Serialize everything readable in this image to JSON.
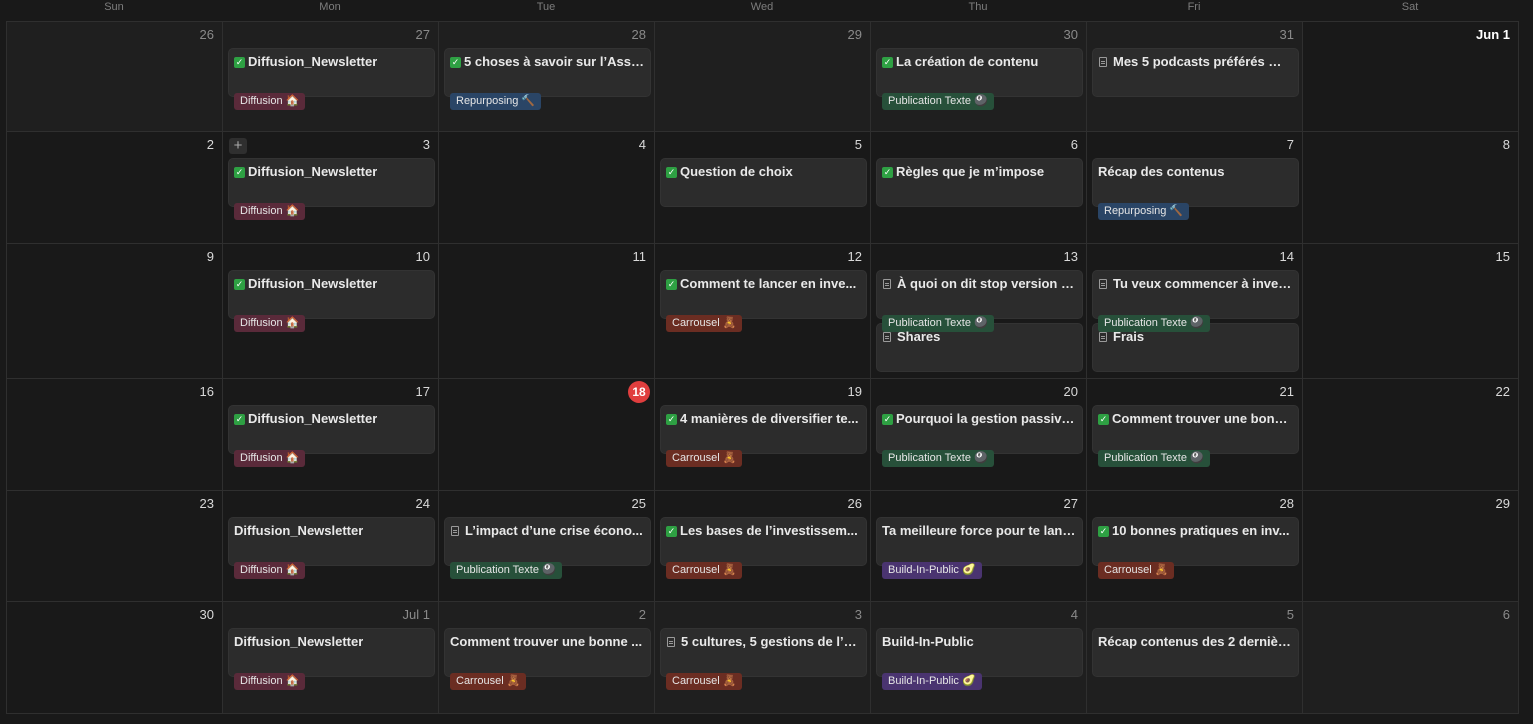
{
  "weekdays": [
    "Sun",
    "Mon",
    "Tue",
    "Wed",
    "Thu",
    "Fri",
    "Sat"
  ],
  "today_label": "18",
  "tag_colors": {
    "Diffusion": "#5a2a3a",
    "Repurposing": "#2a4566",
    "Publication Texte": "#27503a",
    "Carrousel": "#6b2d22",
    "Build-In-Public": "#4a3470"
  },
  "tags": {
    "Diffusion": "Diffusion 🏠",
    "Repurposing": "Repurposing 🔨",
    "Publication Texte": "Publication Texte 🎱",
    "Carrousel": "Carrousel 🧸",
    "Build-In-Public": "Build-In-Public 🥑"
  },
  "weeks": [
    {
      "days": [
        {
          "label": "26",
          "muted": true,
          "events": []
        },
        {
          "label": "27",
          "muted": true,
          "events": [
            {
              "title": "Diffusion_Newsletter",
              "icon": "check",
              "tag": "Diffusion"
            }
          ]
        },
        {
          "label": "28",
          "muted": true,
          "events": [
            {
              "title": "5 choses à savoir sur l’Assu...",
              "icon": "check",
              "tag": "Repurposing"
            }
          ]
        },
        {
          "label": "29",
          "muted": true,
          "events": []
        },
        {
          "label": "30",
          "muted": true,
          "events": [
            {
              "title": "La création de contenu",
              "icon": "check",
              "tag": "Publication Texte"
            }
          ]
        },
        {
          "label": "31",
          "muted": true,
          "events": [
            {
              "title": "Mes 5 podcasts préférés ⤵ ...",
              "icon": "doc",
              "tag": null
            }
          ]
        },
        {
          "label": "Jun 1",
          "muted": false,
          "month_start": true,
          "events": []
        }
      ]
    },
    {
      "add_button": true,
      "days": [
        {
          "label": "2",
          "events": []
        },
        {
          "label": "3",
          "events": [
            {
              "title": "Diffusion_Newsletter",
              "icon": "check",
              "tag": "Diffusion"
            }
          ]
        },
        {
          "label": "4",
          "events": []
        },
        {
          "label": "5",
          "events": [
            {
              "title": "Question de choix",
              "icon": "check",
              "tag": null
            }
          ]
        },
        {
          "label": "6",
          "events": [
            {
              "title": "Règles que je m’impose",
              "icon": "check",
              "tag": null
            }
          ]
        },
        {
          "label": "7",
          "events": [
            {
              "title": "Récap des contenus",
              "icon": null,
              "tag": "Repurposing"
            }
          ]
        },
        {
          "label": "8",
          "events": []
        }
      ]
    },
    {
      "days": [
        {
          "label": "9",
          "events": []
        },
        {
          "label": "10",
          "events": [
            {
              "title": "Diffusion_Newsletter",
              "icon": "check",
              "tag": "Diffusion"
            }
          ]
        },
        {
          "label": "11",
          "events": []
        },
        {
          "label": "12",
          "events": [
            {
              "title": "Comment te lancer en inve...",
              "icon": "check",
              "tag": "Carrousel"
            }
          ]
        },
        {
          "label": "13",
          "events": [
            {
              "title": "À quoi on dit stop version fi...",
              "icon": "doc",
              "tag": "Publication Texte"
            },
            {
              "title": "Shares",
              "icon": "doc",
              "tag": null
            }
          ]
        },
        {
          "label": "14",
          "events": [
            {
              "title": "Tu veux commencer à inves...",
              "icon": "doc",
              "tag": "Publication Texte"
            },
            {
              "title": "Frais",
              "icon": "doc",
              "tag": null
            }
          ]
        },
        {
          "label": "15",
          "events": []
        }
      ]
    },
    {
      "days": [
        {
          "label": "16",
          "events": []
        },
        {
          "label": "17",
          "events": [
            {
              "title": "Diffusion_Newsletter",
              "icon": "check",
              "tag": "Diffusion"
            }
          ]
        },
        {
          "label": "18",
          "today": true,
          "events": []
        },
        {
          "label": "19",
          "events": [
            {
              "title": "4 manières de diversifier te...",
              "icon": "check",
              "tag": "Carrousel"
            }
          ]
        },
        {
          "label": "20",
          "events": [
            {
              "title": "Pourquoi la gestion passive...",
              "icon": "check",
              "tag": "Publication Texte"
            }
          ]
        },
        {
          "label": "21",
          "events": [
            {
              "title": "Comment trouver une bonn...",
              "icon": "check",
              "tag": "Publication Texte"
            }
          ]
        },
        {
          "label": "22",
          "events": []
        }
      ]
    },
    {
      "days": [
        {
          "label": "23",
          "events": []
        },
        {
          "label": "24",
          "events": [
            {
              "title": "Diffusion_Newsletter",
              "icon": null,
              "tag": "Diffusion"
            }
          ]
        },
        {
          "label": "25",
          "events": [
            {
              "title": "L’impact d’une crise écono...",
              "icon": "doc",
              "tag": "Publication Texte"
            }
          ]
        },
        {
          "label": "26",
          "events": [
            {
              "title": "Les bases de l’investissem...",
              "icon": "check",
              "tag": "Carrousel"
            }
          ]
        },
        {
          "label": "27",
          "events": [
            {
              "title": "Ta meilleure force pour te lanc...",
              "icon": null,
              "tag": "Build-In-Public"
            }
          ]
        },
        {
          "label": "28",
          "events": [
            {
              "title": "10 bonnes pratiques en inv...",
              "icon": "check",
              "tag": "Carrousel"
            }
          ]
        },
        {
          "label": "29",
          "events": []
        }
      ]
    },
    {
      "days": [
        {
          "label": "30",
          "events": []
        },
        {
          "label": "Jul 1",
          "muted": true,
          "events": [
            {
              "title": "Diffusion_Newsletter",
              "icon": null,
              "tag": "Diffusion"
            }
          ]
        },
        {
          "label": "2",
          "muted": true,
          "events": [
            {
              "title": "Comment trouver une bonne ...",
              "icon": null,
              "tag": "Carrousel"
            }
          ]
        },
        {
          "label": "3",
          "muted": true,
          "events": [
            {
              "title": "5 cultures, 5 gestions de l’a...",
              "icon": "doc",
              "tag": "Carrousel"
            }
          ]
        },
        {
          "label": "4",
          "muted": true,
          "events": [
            {
              "title": "Build-In-Public",
              "icon": null,
              "tag": "Build-In-Public"
            }
          ]
        },
        {
          "label": "5",
          "muted": true,
          "events": [
            {
              "title": "Récap contenus des 2 dernièr...",
              "icon": null,
              "tag": null
            }
          ]
        },
        {
          "label": "6",
          "muted": true,
          "events": []
        }
      ]
    }
  ]
}
